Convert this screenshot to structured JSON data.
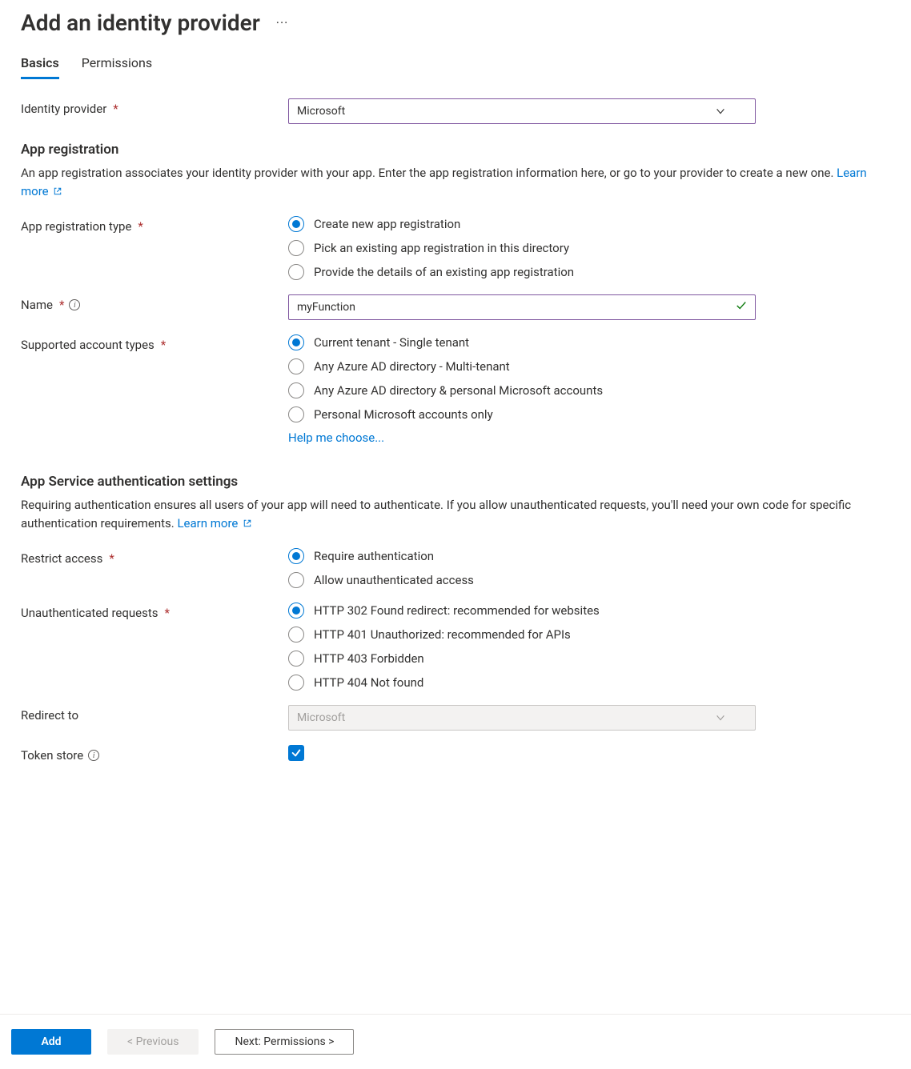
{
  "header": {
    "title": "Add an identity provider"
  },
  "tabs": {
    "basics": "Basics",
    "permissions": "Permissions"
  },
  "identity_provider": {
    "label": "Identity provider",
    "value": "Microsoft"
  },
  "app_registration": {
    "heading": "App registration",
    "description": "An app registration associates your identity provider with your app. Enter the app registration information here, or go to your provider to create a new one. ",
    "learn_more": "Learn more",
    "type_label": "App registration type",
    "type_options": {
      "create_new": "Create new app registration",
      "pick_existing": "Pick an existing app registration in this directory",
      "provide_details": "Provide the details of an existing app registration"
    },
    "name_label": "Name",
    "name_value": "myFunction",
    "supported_types_label": "Supported account types",
    "supported_types_options": {
      "single_tenant": "Current tenant - Single tenant",
      "multi_tenant": "Any Azure AD directory - Multi-tenant",
      "multi_personal": "Any Azure AD directory & personal Microsoft accounts",
      "personal_only": "Personal Microsoft accounts only"
    },
    "help_me_choose": "Help me choose..."
  },
  "auth_settings": {
    "heading": "App Service authentication settings",
    "description": "Requiring authentication ensures all users of your app will need to authenticate. If you allow unauthenticated requests, you'll need your own code for specific authentication requirements. ",
    "learn_more": "Learn more",
    "restrict_access_label": "Restrict access",
    "restrict_access_options": {
      "require": "Require authentication",
      "allow": "Allow unauthenticated access"
    },
    "unauth_requests_label": "Unauthenticated requests",
    "unauth_requests_options": {
      "http302": "HTTP 302 Found redirect: recommended for websites",
      "http401": "HTTP 401 Unauthorized: recommended for APIs",
      "http403": "HTTP 403 Forbidden",
      "http404": "HTTP 404 Not found"
    },
    "redirect_to_label": "Redirect to",
    "redirect_to_value": "Microsoft",
    "token_store_label": "Token store"
  },
  "footer": {
    "add": "Add",
    "previous": "<  Previous",
    "next": "Next: Permissions  >"
  }
}
